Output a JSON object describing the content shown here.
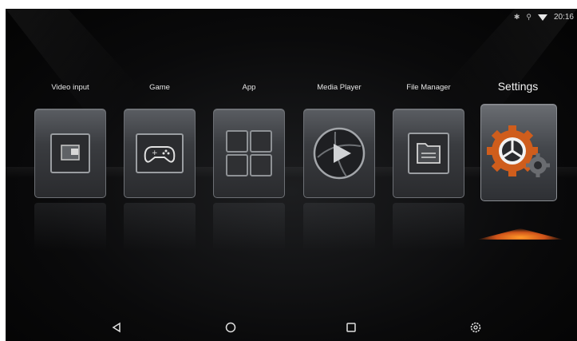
{
  "status": {
    "icons": [
      "bluetooth-icon",
      "usb-icon",
      "wifi-icon"
    ],
    "time": "20:16"
  },
  "apps": [
    {
      "label": "Video input",
      "icon": "video-input-icon"
    },
    {
      "label": "Game",
      "icon": "gamepad-icon"
    },
    {
      "label": "App",
      "icon": "app-grid-icon"
    },
    {
      "label": "Media Player",
      "icon": "media-player-icon"
    },
    {
      "label": "File Manager",
      "icon": "folder-icon"
    },
    {
      "label": "Settings",
      "icon": "settings-gears-icon",
      "selected": true
    }
  ],
  "nav": [
    "back-icon",
    "home-icon",
    "recents-icon",
    "settings-icon"
  ],
  "colors": {
    "background": "#0b0b0c",
    "tile": "#3a3c40",
    "selection_glow": "#ff8a24",
    "text": "#e6e6e6"
  }
}
